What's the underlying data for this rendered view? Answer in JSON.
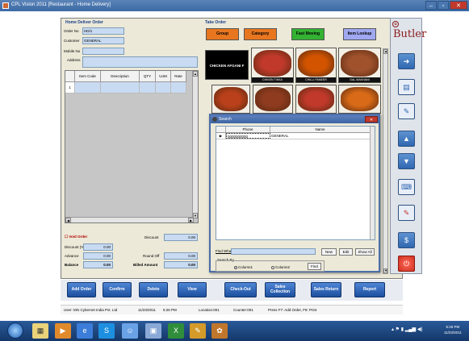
{
  "window": {
    "title": "CPL Vision 2011 [Restaurant - Home Delivery]",
    "controls": [
      "–",
      "▫",
      "✕"
    ]
  },
  "home_delivery": {
    "title": "Home Deliver Order",
    "order_no_label": "Order No",
    "order_no": "HD/1",
    "customer_label": "Customer",
    "customer": "GENERAL",
    "mobile_label": "Mobile No",
    "mobile": "",
    "address_label": "Address",
    "address": ""
  },
  "items_grid": {
    "columns": [
      "",
      "Item Code",
      "Description",
      "QTY",
      "UoM",
      "Rate"
    ],
    "rows": [
      {
        "num": "1",
        "code": "",
        "desc": "",
        "qty": "",
        "uom": "",
        "rate": ""
      }
    ]
  },
  "totals": {
    "void_order": "Void Order",
    "discount_label": "Discount",
    "discount_pct_label": "Discount (%)",
    "discount_pct": "0.00",
    "discount_value": "0.00",
    "advance_label": "Advance",
    "advance": "0.00",
    "round_off_label": "Round Off",
    "round_off": "0.00",
    "balance_label": "Balance",
    "balance": "0.00",
    "billed_label": "Billed Amount",
    "billed": "0.00"
  },
  "take_order": {
    "title": "Take Order",
    "buttons": [
      {
        "label": "Group",
        "color": "#e8761f"
      },
      {
        "label": "Category",
        "color": "#e8761f"
      },
      {
        "label": "Fast Moving",
        "color": "#34b233"
      },
      {
        "label": "Item Lookup",
        "color": "#9fa8f0"
      }
    ],
    "tiles": [
      {
        "label": "CHICKEN AFGANI F",
        "type": "name"
      },
      {
        "label": "CHIKEN TIKKA",
        "color": "#c0392b"
      },
      {
        "label": "CHILLI PANEER",
        "color": "#d35400"
      },
      {
        "label": "DAL MAKHANI",
        "color": "#a0522d"
      },
      {
        "label": "",
        "color": "#b9401a"
      },
      {
        "label": "",
        "color": "#8e3b1f"
      },
      {
        "label": "",
        "color": "#c0392b"
      },
      {
        "label": "",
        "color": "#d86a18"
      }
    ]
  },
  "search_dialog": {
    "title": "Search",
    "columns": [
      "Phone",
      "Name"
    ],
    "rows": [
      {
        "phone": "0000000000",
        "name": "GENERAL"
      }
    ],
    "find_what_label": "Find What",
    "find_what": "",
    "new_label": "New",
    "edit_label": "Edit",
    "show_all_label": "Show All",
    "search_by_label": "Search By",
    "column1_label": "Column1",
    "column2_label": "Column2",
    "find_label": "Find"
  },
  "sidebar": {
    "logo": "Butler"
  },
  "actions": [
    {
      "label": "Add Order"
    },
    {
      "label": "Confirm"
    },
    {
      "label": "Delete"
    },
    {
      "label": "View"
    },
    {
      "label": "Check-Out"
    },
    {
      "label": "Sales Collection"
    },
    {
      "label": "Sales Return"
    },
    {
      "label": "Report"
    }
  ],
  "status": {
    "user": "User: M/s Cybernet India Pvt. Ltd",
    "date": "11/23/2011",
    "time": "5:26 PM",
    "location": "Location:001",
    "counter": "Counter:001",
    "hint": "Press F7: Add Order, F8: Print"
  },
  "taskbar": {
    "clock_time": "5:26 PM",
    "clock_date": "11/23/2011"
  }
}
